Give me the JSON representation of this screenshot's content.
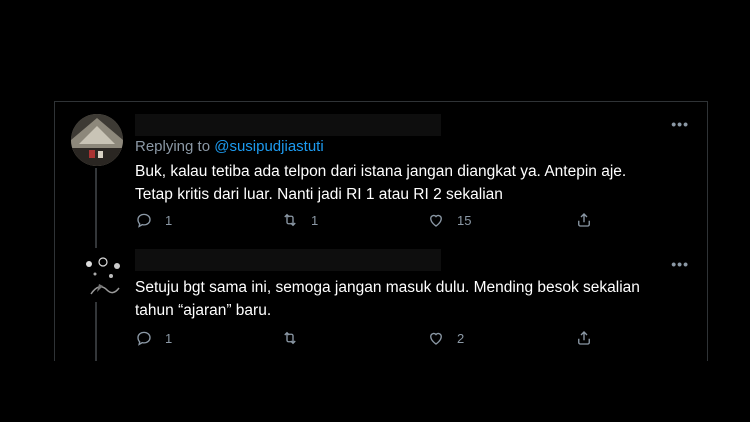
{
  "thread": {
    "tweets": [
      {
        "replying_prefix": "Replying to",
        "replying_handle": "@susipudjiastuti",
        "text_line1": "Buk, kalau tetiba ada telpon dari istana jangan diangkat ya. Antepin aje.",
        "text_line2": "Tetap kritis dari luar. Nanti jadi RI 1 atau RI 2 sekalian",
        "reply_count": "1",
        "retweet_count": "1",
        "like_count": "15",
        "more_label": "•••"
      },
      {
        "text_line1": "Setuju bgt sama ini, semoga jangan masuk dulu. Mending besok sekalian",
        "text_line2": "tahun “ajaran” baru.",
        "reply_count": "1",
        "retweet_count": "",
        "like_count": "2",
        "more_label": "•••"
      }
    ]
  },
  "colors": {
    "background": "#000000",
    "text": "#ffffff",
    "muted": "#8b98a5",
    "link": "#1d9bf0"
  },
  "icons": [
    "reply-icon",
    "retweet-icon",
    "like-icon",
    "share-icon",
    "more-icon"
  ]
}
